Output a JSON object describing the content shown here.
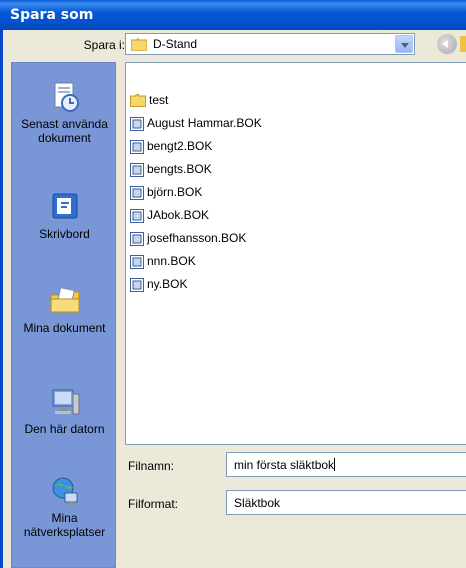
{
  "window": {
    "title": "Spara som"
  },
  "save_in": {
    "label": "Spara i:",
    "value": "D-Stand"
  },
  "places": [
    {
      "label": "Senast använda dokument",
      "icon": "recent-documents-icon"
    },
    {
      "label": "Skrivbord",
      "icon": "desktop-icon"
    },
    {
      "label": "Mina dokument",
      "icon": "my-documents-icon"
    },
    {
      "label": "Den här datorn",
      "icon": "my-computer-icon"
    },
    {
      "label": "Mina nätverksplatser",
      "icon": "network-places-icon"
    }
  ],
  "files": [
    {
      "name": "test",
      "type": "folder"
    },
    {
      "name": "August Hammar.BOK",
      "type": "file"
    },
    {
      "name": "bengt2.BOK",
      "type": "file"
    },
    {
      "name": "bengts.BOK",
      "type": "file"
    },
    {
      "name": "björn.BOK",
      "type": "file"
    },
    {
      "name": "JAbok.BOK",
      "type": "file"
    },
    {
      "name": "josefhansson.BOK",
      "type": "file"
    },
    {
      "name": "nnn.BOK",
      "type": "file"
    },
    {
      "name": "ny.BOK",
      "type": "file"
    }
  ],
  "filename": {
    "label": "Filnamn:",
    "value": "min första släktbok"
  },
  "fileformat": {
    "label": "Filformat:",
    "value": "Släktbok"
  },
  "colors": {
    "titlebar": "#0454d0",
    "places_bar": "#7996d6",
    "dialog_bg": "#ece9d8"
  }
}
